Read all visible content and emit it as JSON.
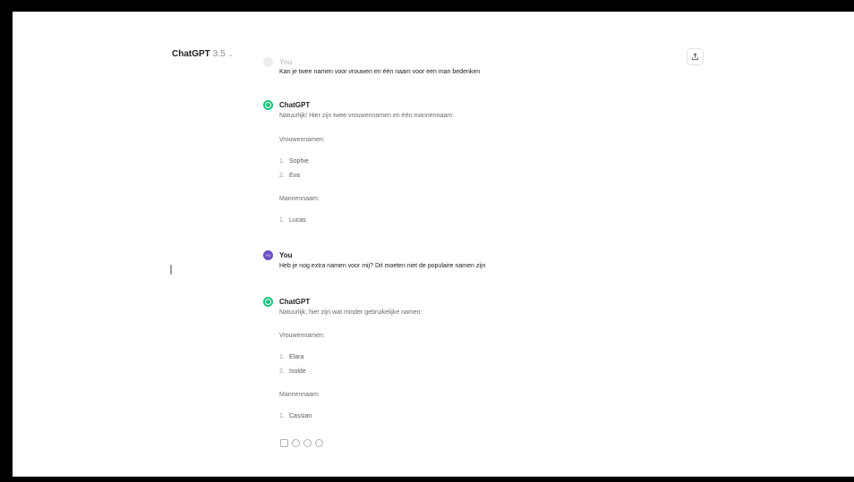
{
  "header": {
    "model_name": "ChatGPT",
    "model_version": "3.5"
  },
  "messages": [
    {
      "role": "user",
      "author": "You",
      "text": "Kan je twee namen voor vrouwen en één naam voor een man bedenken"
    },
    {
      "role": "assistant",
      "author": "ChatGPT",
      "intro": "Natuurlijk! Hier zijn twee vrouwennamen en één mannennaam:",
      "women_heading": "Vrouwennamen:",
      "women": [
        {
          "num": "1.",
          "name": "Sophie"
        },
        {
          "num": "2.",
          "name": "Eva"
        }
      ],
      "men_heading": "Mannennaam:",
      "men": [
        {
          "num": "1.",
          "name": "Lucas"
        }
      ]
    },
    {
      "role": "user",
      "author": "You",
      "avatar_initials": "YO",
      "text": "Heb je nog extra namen voor mij? Dit moeten niet de populaire namen zijn"
    },
    {
      "role": "assistant",
      "author": "ChatGPT",
      "intro": "Natuurlijk, hier zijn wat minder gebruikelijke namen:",
      "women_heading": "Vrouwennamen:",
      "women": [
        {
          "num": "1.",
          "name": "Elara"
        },
        {
          "num": "2.",
          "name": "Isolde"
        }
      ],
      "men_heading": "Mannennaam:",
      "men": [
        {
          "num": "1.",
          "name": "Cassian"
        }
      ]
    }
  ],
  "message_actions": [
    "copy-icon",
    "thumbs-up-icon",
    "regenerate-icon",
    "thumbs-down-icon"
  ]
}
